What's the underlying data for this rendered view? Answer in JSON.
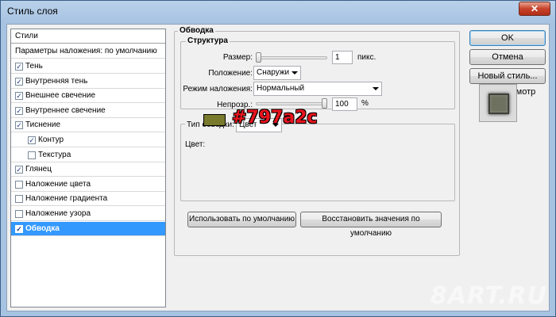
{
  "window": {
    "title": "Стиль слоя",
    "close_glyph": "✕"
  },
  "styles_list": {
    "header": "Стили",
    "blend_defaults": "Параметры наложения: по умолчанию",
    "items": [
      {
        "label": "Тень",
        "checked": true
      },
      {
        "label": "Внутренняя тень",
        "checked": true
      },
      {
        "label": "Внешнее свечение",
        "checked": true
      },
      {
        "label": "Внутреннее свечение",
        "checked": true
      },
      {
        "label": "Тиснение",
        "checked": true
      },
      {
        "label": "Контур",
        "checked": true
      },
      {
        "label": "Текстура",
        "checked": false
      },
      {
        "label": "Глянец",
        "checked": true
      },
      {
        "label": "Наложение цвета",
        "checked": false
      },
      {
        "label": "Наложение градиента",
        "checked": false
      },
      {
        "label": "Наложение узора",
        "checked": false
      },
      {
        "label": "Обводка",
        "checked": true
      }
    ],
    "check_glyph": "✓"
  },
  "stroke": {
    "group_title": "Обводка",
    "structure_title": "Структура",
    "size_label": "Размер:",
    "size_value": "1",
    "size_unit": "пикс.",
    "position_label": "Положение:",
    "position_value": "Снаружи",
    "blend_label": "Режим наложения:",
    "blend_value": "Нормальный",
    "opacity_label": "Непрозр.:",
    "opacity_value": "100",
    "opacity_unit": "%",
    "opacity_level": 1.0,
    "size_level": 0.0,
    "fill_type_label": "Тип обводки:",
    "fill_type_value": "Цвет",
    "color_label": "Цвет:",
    "color_hex": "#797a2c",
    "annotation": "#797a2c",
    "default_button": "Использовать по умолчанию",
    "reset_button": "Восстановить значения по умолчанию"
  },
  "buttons": {
    "ok": "OK",
    "cancel": "Отмена",
    "new_style": "Новый стиль...",
    "preview_label": "Просмотр",
    "preview_checked": true
  },
  "watermark": "8ART.RU",
  "colors": {
    "selection": "#3399ff",
    "annotation_text": "#e8141e"
  }
}
